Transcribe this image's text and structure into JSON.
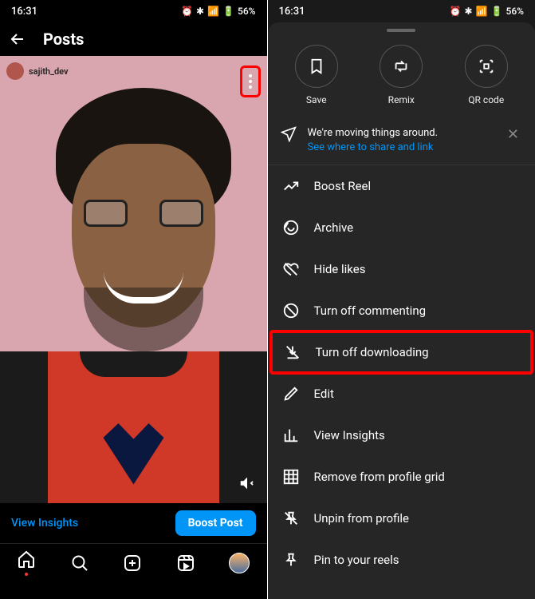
{
  "status": {
    "time": "16:31",
    "battery": "56%"
  },
  "header": {
    "title": "Posts"
  },
  "post": {
    "username": "sajith_dev",
    "muted": true
  },
  "bottom": {
    "insights": "View Insights",
    "boost": "Boost Post"
  },
  "sheet": {
    "circles": {
      "save": "Save",
      "remix": "Remix",
      "qr": "QR code"
    },
    "notice": {
      "line1": "We're moving things around.",
      "link": "See where to share and link"
    },
    "items": {
      "boost": "Boost Reel",
      "archive": "Archive",
      "hide_likes": "Hide likes",
      "turn_off_commenting": "Turn off commenting",
      "turn_off_downloading": "Turn off downloading",
      "edit": "Edit",
      "view_insights": "View Insights",
      "remove_grid": "Remove from profile grid",
      "unpin": "Unpin from profile",
      "pin_reels": "Pin to your reels"
    }
  }
}
